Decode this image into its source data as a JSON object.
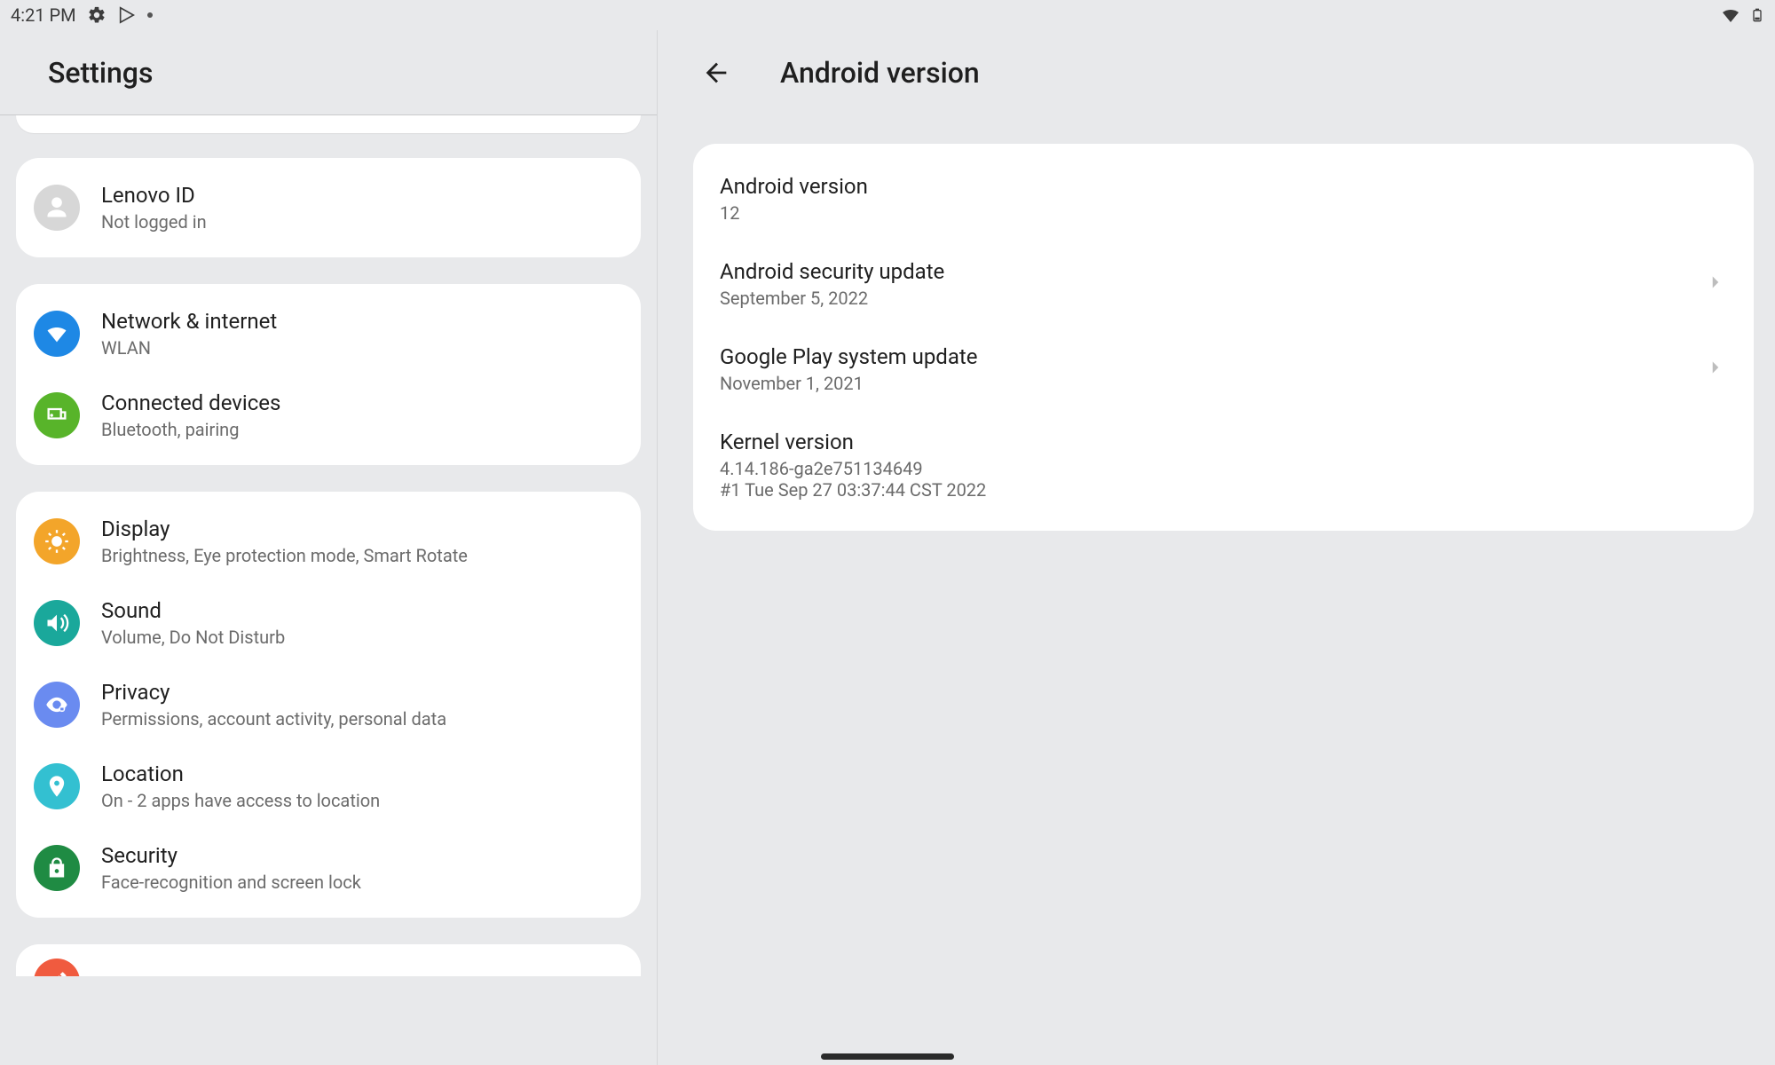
{
  "status": {
    "time": "4:21 PM"
  },
  "left": {
    "title": "Settings",
    "account": {
      "title": "Lenovo ID",
      "sub": "Not logged in"
    },
    "group1": [
      {
        "id": "network",
        "title": "Network & internet",
        "sub": "WLAN",
        "color": "#1e88e5"
      },
      {
        "id": "connected",
        "title": "Connected devices",
        "sub": "Bluetooth, pairing",
        "color": "#58b42a"
      }
    ],
    "group2": [
      {
        "id": "display",
        "title": "Display",
        "sub": "Brightness, Eye protection mode, Smart Rotate",
        "color": "#f3a52a"
      },
      {
        "id": "sound",
        "title": "Sound",
        "sub": "Volume, Do Not Disturb",
        "color": "#1aa89b"
      },
      {
        "id": "privacy",
        "title": "Privacy",
        "sub": "Permissions, account activity, personal data",
        "color": "#6a8bf0"
      },
      {
        "id": "location",
        "title": "Location",
        "sub": "On - 2 apps have access to location",
        "color": "#33c0d1"
      },
      {
        "id": "security",
        "title": "Security",
        "sub": "Face-recognition and screen lock",
        "color": "#1f8b43"
      }
    ],
    "peek": {
      "id": "lenovopen",
      "color": "#f05b3f"
    }
  },
  "right": {
    "title": "Android version",
    "items": [
      {
        "id": "android_version",
        "title": "Android version",
        "sub": "12",
        "chevron": false,
        "interact": true
      },
      {
        "id": "security_update",
        "title": "Android security update",
        "sub": "September 5, 2022",
        "chevron": true,
        "interact": true
      },
      {
        "id": "play_update",
        "title": "Google Play system update",
        "sub": "November 1, 2021",
        "chevron": true,
        "interact": true
      },
      {
        "id": "kernel",
        "title": "Kernel version",
        "sub": "4.14.186-ga2e751134649\n#1 Tue Sep 27 03:37:44 CST 2022",
        "chevron": false,
        "interact": true
      }
    ]
  }
}
